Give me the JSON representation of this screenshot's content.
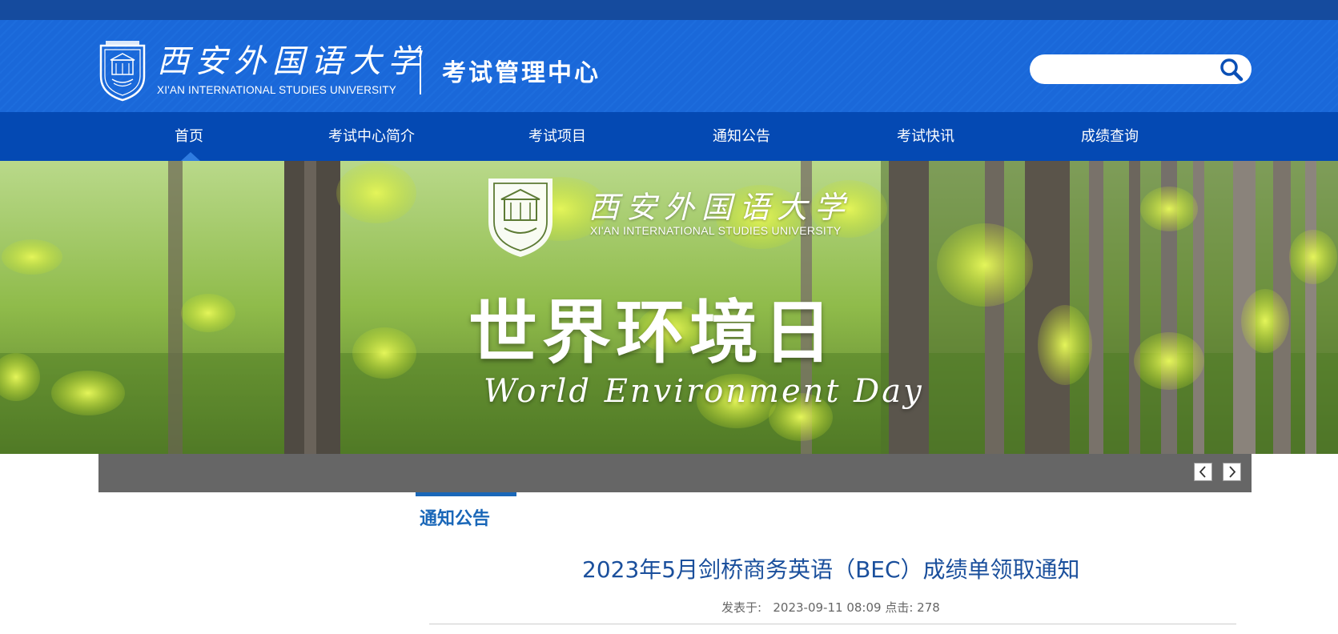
{
  "header": {
    "logo_cn": "西安外国语大学",
    "logo_en": "XI'AN INTERNATIONAL STUDIES UNIVERSITY",
    "site_title": "考试管理中心",
    "search": {
      "value": "",
      "icon": "search-icon"
    }
  },
  "nav": {
    "items": [
      {
        "label": "首页",
        "active": true
      },
      {
        "label": "考试中心简介"
      },
      {
        "label": "考试项目"
      },
      {
        "label": "通知公告"
      },
      {
        "label": "考试快讯"
      },
      {
        "label": "成绩查询"
      }
    ]
  },
  "banner": {
    "univ_cn": "西安外国语大学",
    "univ_en": "XI'AN INTERNATIONAL STUDIES UNIVERSITY",
    "headline": "世界环境日",
    "subtitle": "World Environment Day",
    "prev_icon": "chevron-left-icon",
    "next_icon": "chevron-right-icon"
  },
  "section": {
    "title": "通知公告"
  },
  "article": {
    "title": "2023年5月剑桥商务英语（BEC）成绩单领取通知",
    "published_label": "发表于:",
    "published_value": "2023-09-11 08:09",
    "clicks_label": "点击:",
    "clicks_value": "278"
  },
  "colors": {
    "header_blue": "#1a68d9",
    "nav_blue": "#0449b3",
    "top_strip": "#154b9e",
    "accent": "#1a67b8",
    "caption_bar": "#666666"
  }
}
